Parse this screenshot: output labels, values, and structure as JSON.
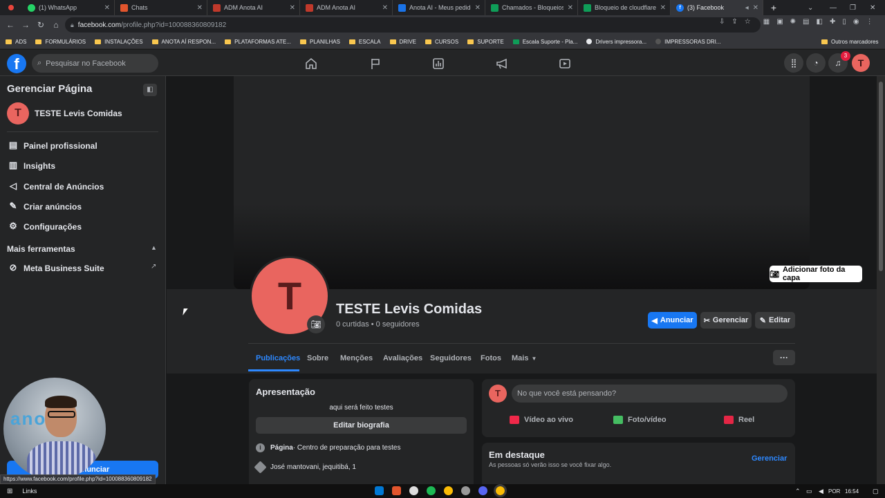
{
  "browser": {
    "tabs": [
      {
        "title": "(1) WhatsApp",
        "color": "#25d366"
      },
      {
        "title": "Chats",
        "color": "#e2552d"
      },
      {
        "title": "ADM Anota AI",
        "color": "#c0392b"
      },
      {
        "title": "ADM Anota AI",
        "color": "#c0392b"
      },
      {
        "title": "Anota AI - Meus pedidos",
        "color": "#1a73e8"
      },
      {
        "title": "Chamados - Bloqueios C",
        "color": "#0f9d58"
      },
      {
        "title": "Bloqueio de cloudflare - ",
        "color": "#0f9d58"
      },
      {
        "title": "(3) Facebook",
        "color": "#1877f2"
      }
    ],
    "new_tab": "+",
    "url_domain": "facebook.com",
    "url_path": "/profile.php?id=100088360809182",
    "bookmarks": [
      "ADS",
      "FORMULÁRIOS",
      "INSTALAÇÕES",
      "ANOTA AÍ RESPON...",
      "PLATAFORMAS ATE...",
      "PLANILHAS",
      "ESCALA",
      "DRIVE",
      "CURSOS",
      "SUPORTE",
      "Escala Suporte - Pla...",
      "Drivers impressora...",
      "IMPRESSORAS DRI..."
    ],
    "other_bookmarks": "Outros marcadores",
    "status_url": "https://www.facebook.com/profile.php?id=100088360809182"
  },
  "fb": {
    "logo": "f",
    "search_placeholder": "Pesquisar no Facebook",
    "notifications": "3",
    "avatar_letter": "T"
  },
  "sidebar": {
    "title": "Gerenciar Página",
    "page_name": "TESTE Levis Comidas",
    "items": [
      {
        "label": "Painel profissional",
        "icon": "dashboard-icon"
      },
      {
        "label": "Insights",
        "icon": "insights-icon"
      },
      {
        "label": "Central de Anúncios",
        "icon": "megaphone-icon"
      },
      {
        "label": "Criar anúncios",
        "icon": "edit-icon"
      },
      {
        "label": "Configurações",
        "icon": "gear-icon"
      }
    ],
    "more_tools": "Mais ferramentas",
    "meta_suite": "Meta Business Suite",
    "advertise_button": "Anunciar",
    "webcam_brand": "anota"
  },
  "profile": {
    "add_cover": "Adicionar foto da capa",
    "avatar_letter": "T",
    "name": "TESTE Levis Comidas",
    "stats": "0 curtidas • 0 seguidores",
    "btn_advertise": "Anunciar",
    "btn_manage": "Gerenciar",
    "btn_edit": "Editar",
    "tabs": [
      "Publicações",
      "Sobre",
      "Menções",
      "Avaliações",
      "Seguidores",
      "Fotos",
      "Mais"
    ],
    "more": "···"
  },
  "intro": {
    "title": "Apresentação",
    "bio": "aqui será feito testes",
    "edit_bio": "Editar biografia",
    "page_label": "Página",
    "page_category": " · Centro de preparação para testes",
    "address": "José mantovani, jequitibá, 1"
  },
  "composer": {
    "placeholder": "No que você está pensando?",
    "live": "Vídeo ao vivo",
    "photo": "Foto/vídeo",
    "reel": "Reel"
  },
  "featured": {
    "title": "Em destaque",
    "subtitle": "As pessoas só verão isso se você fixar algo.",
    "manage": "Gerenciar"
  },
  "taskbar": {
    "links": "Links",
    "lang": "POR",
    "time": "16:54"
  }
}
